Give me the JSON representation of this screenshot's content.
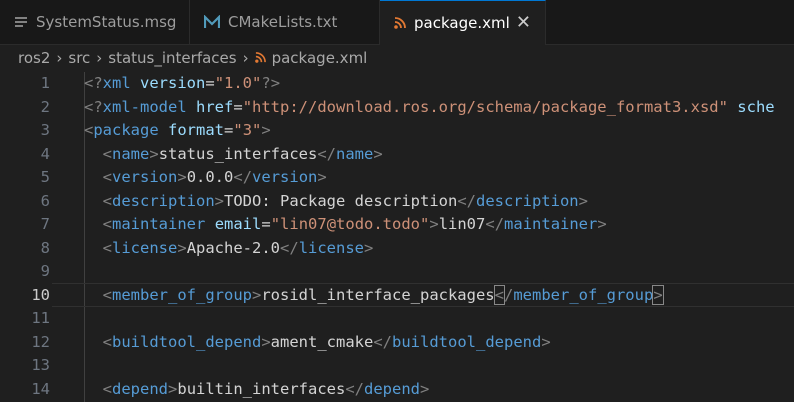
{
  "tabs": [
    {
      "label": "SystemStatus.msg",
      "icon": "file-lines-icon",
      "active": false
    },
    {
      "label": "CMakeLists.txt",
      "icon": "cmake-m-icon",
      "active": false
    },
    {
      "label": "package.xml",
      "icon": "rss-icon",
      "active": true
    }
  ],
  "breadcrumb": [
    "ros2",
    "src",
    "status_interfaces",
    "package.xml"
  ],
  "lines": [
    {
      "n": "1",
      "seg": [
        {
          "c": "p",
          "t": "<?"
        },
        {
          "c": "t",
          "t": "xml"
        },
        {
          "c": "x",
          "t": " "
        },
        {
          "c": "a",
          "t": "version"
        },
        {
          "c": "x",
          "t": "="
        },
        {
          "c": "s",
          "t": "\"1.0\""
        },
        {
          "c": "p",
          "t": "?>"
        }
      ]
    },
    {
      "n": "2",
      "seg": [
        {
          "c": "p",
          "t": "<?"
        },
        {
          "c": "t",
          "t": "xml-model"
        },
        {
          "c": "x",
          "t": " "
        },
        {
          "c": "a",
          "t": "href"
        },
        {
          "c": "x",
          "t": "="
        },
        {
          "c": "s",
          "t": "\"http://download.ros.org/schema/package_format3.xsd\""
        },
        {
          "c": "x",
          "t": " "
        },
        {
          "c": "a",
          "t": "sche"
        }
      ]
    },
    {
      "n": "3",
      "seg": [
        {
          "c": "p",
          "t": "<"
        },
        {
          "c": "t",
          "t": "package"
        },
        {
          "c": "x",
          "t": " "
        },
        {
          "c": "a",
          "t": "format"
        },
        {
          "c": "x",
          "t": "="
        },
        {
          "c": "s",
          "t": "\"3\""
        },
        {
          "c": "p",
          "t": ">"
        }
      ]
    },
    {
      "n": "4",
      "seg": [
        {
          "c": "x",
          "t": "  "
        },
        {
          "c": "p",
          "t": "<"
        },
        {
          "c": "t",
          "t": "name"
        },
        {
          "c": "p",
          "t": ">"
        },
        {
          "c": "x",
          "t": "status_interfaces"
        },
        {
          "c": "p",
          "t": "</"
        },
        {
          "c": "t",
          "t": "name"
        },
        {
          "c": "p",
          "t": ">"
        }
      ]
    },
    {
      "n": "5",
      "seg": [
        {
          "c": "x",
          "t": "  "
        },
        {
          "c": "p",
          "t": "<"
        },
        {
          "c": "t",
          "t": "version"
        },
        {
          "c": "p",
          "t": ">"
        },
        {
          "c": "x",
          "t": "0.0.0"
        },
        {
          "c": "p",
          "t": "</"
        },
        {
          "c": "t",
          "t": "version"
        },
        {
          "c": "p",
          "t": ">"
        }
      ]
    },
    {
      "n": "6",
      "seg": [
        {
          "c": "x",
          "t": "  "
        },
        {
          "c": "p",
          "t": "<"
        },
        {
          "c": "t",
          "t": "description"
        },
        {
          "c": "p",
          "t": ">"
        },
        {
          "c": "x",
          "t": "TODO: Package description"
        },
        {
          "c": "p",
          "t": "</"
        },
        {
          "c": "t",
          "t": "description"
        },
        {
          "c": "p",
          "t": ">"
        }
      ]
    },
    {
      "n": "7",
      "seg": [
        {
          "c": "x",
          "t": "  "
        },
        {
          "c": "p",
          "t": "<"
        },
        {
          "c": "t",
          "t": "maintainer"
        },
        {
          "c": "x",
          "t": " "
        },
        {
          "c": "a",
          "t": "email"
        },
        {
          "c": "x",
          "t": "="
        },
        {
          "c": "s",
          "t": "\"lin07@todo.todo\""
        },
        {
          "c": "p",
          "t": ">"
        },
        {
          "c": "x",
          "t": "lin07"
        },
        {
          "c": "p",
          "t": "</"
        },
        {
          "c": "t",
          "t": "maintainer"
        },
        {
          "c": "p",
          "t": ">"
        }
      ]
    },
    {
      "n": "8",
      "seg": [
        {
          "c": "x",
          "t": "  "
        },
        {
          "c": "p",
          "t": "<"
        },
        {
          "c": "t",
          "t": "license"
        },
        {
          "c": "p",
          "t": ">"
        },
        {
          "c": "x",
          "t": "Apache-2.0"
        },
        {
          "c": "p",
          "t": "</"
        },
        {
          "c": "t",
          "t": "license"
        },
        {
          "c": "p",
          "t": ">"
        }
      ]
    },
    {
      "n": "9",
      "seg": []
    },
    {
      "n": "10",
      "current": true,
      "seg": [
        {
          "c": "x",
          "t": "  "
        },
        {
          "c": "p",
          "t": "<"
        },
        {
          "c": "t",
          "t": "member_of_group"
        },
        {
          "c": "p",
          "t": ">"
        },
        {
          "c": "x",
          "t": "rosidl_interface_packages"
        },
        {
          "c": "p",
          "t": "<",
          "box": true
        },
        {
          "c": "p",
          "t": "/"
        },
        {
          "c": "t",
          "t": "member_of_group"
        },
        {
          "c": "p",
          "t": ">",
          "box": true
        }
      ]
    },
    {
      "n": "11",
      "seg": []
    },
    {
      "n": "12",
      "seg": [
        {
          "c": "x",
          "t": "  "
        },
        {
          "c": "p",
          "t": "<"
        },
        {
          "c": "t",
          "t": "buildtool_depend"
        },
        {
          "c": "p",
          "t": ">"
        },
        {
          "c": "x",
          "t": "ament_cmake"
        },
        {
          "c": "p",
          "t": "</"
        },
        {
          "c": "t",
          "t": "buildtool_depend"
        },
        {
          "c": "p",
          "t": ">"
        }
      ]
    },
    {
      "n": "13",
      "seg": []
    },
    {
      "n": "14",
      "seg": [
        {
          "c": "x",
          "t": "  "
        },
        {
          "c": "p",
          "t": "<"
        },
        {
          "c": "t",
          "t": "depend"
        },
        {
          "c": "p",
          "t": ">"
        },
        {
          "c": "x",
          "t": "builtin_interfaces"
        },
        {
          "c": "p",
          "t": "</"
        },
        {
          "c": "t",
          "t": "depend"
        },
        {
          "c": "p",
          "t": ">"
        }
      ]
    }
  ],
  "colors": {
    "tag": "#569cd6",
    "attr": "#9cdcfe",
    "string": "#ce9178",
    "punct": "#808080",
    "text": "#d4d4d4",
    "accent": "#0078d4",
    "rss": "#e37933",
    "cmake": "#519aba"
  }
}
